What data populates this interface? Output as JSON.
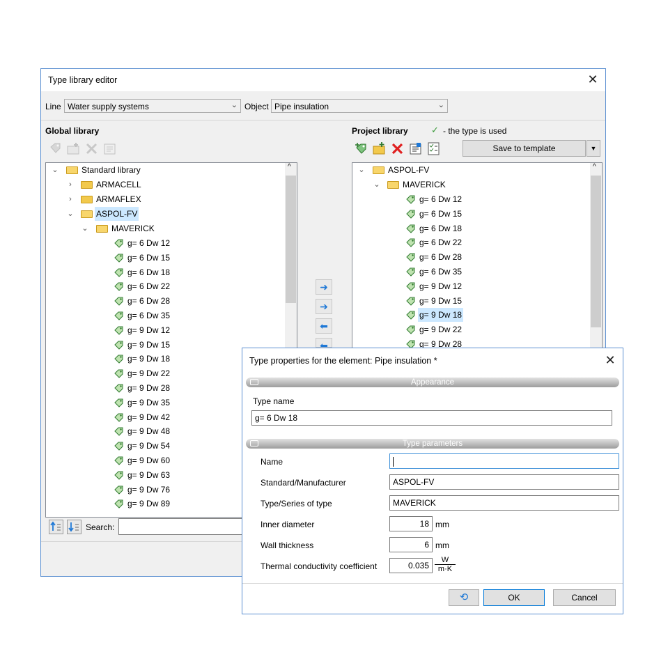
{
  "main_window": {
    "title": "Type library editor",
    "line_label": "Line",
    "line_value": "Water supply systems",
    "object_label": "Object",
    "object_value": "Pipe insulation",
    "global_library_label": "Global library",
    "project_library_label": "Project library",
    "used_legend": "- the type is used",
    "save_to_template_label": "Save to template",
    "search_label": "Search:",
    "search_value": ""
  },
  "global_tree": {
    "root": "Standard library",
    "folders": [
      "ARMACELL",
      "ARMAFLEX",
      "ASPOL-FV"
    ],
    "subfolder": "MAVERICK",
    "items": [
      "g= 6 Dw 12",
      "g= 6 Dw 15",
      "g= 6 Dw 18",
      "g= 6 Dw 22",
      "g= 6 Dw 28",
      "g= 6 Dw 35",
      "g= 9 Dw 12",
      "g= 9 Dw 15",
      "g= 9 Dw 18",
      "g= 9 Dw 22",
      "g= 9 Dw 28",
      "g= 9 Dw 35",
      "g= 9 Dw 42",
      "g= 9 Dw 48",
      "g= 9 Dw 54",
      "g= 9 Dw 60",
      "g= 9 Dw 63",
      "g= 9 Dw 76",
      "g= 9 Dw 89"
    ],
    "selected": "ASPOL-FV"
  },
  "project_tree": {
    "root": "ASPOL-FV",
    "subfolder": "MAVERICK",
    "items": [
      "g= 6 Dw 12",
      "g= 6 Dw 15",
      "g= 6 Dw 18",
      "g= 6 Dw 22",
      "g= 6 Dw 28",
      "g= 6 Dw 35",
      "g= 9 Dw 12",
      "g= 9 Dw 15",
      "g= 9 Dw 18",
      "g= 9 Dw 22",
      "g= 9 Dw 28"
    ],
    "selected": "g= 9 Dw 18"
  },
  "dialog": {
    "title": "Type properties for the element: Pipe insulation *",
    "appearance_section": "Appearance",
    "type_name_label": "Type name",
    "type_name_value": "g= 6 Dw 18",
    "type_parameters_section": "Type parameters",
    "name_label": "Name",
    "name_value": "",
    "manufacturer_label": "Standard/Manufacturer",
    "manufacturer_value": "ASPOL-FV",
    "series_label": "Type/Series of type",
    "series_value": "MAVERICK",
    "inner_diameter_label": "Inner diameter",
    "inner_diameter_value": "18",
    "inner_diameter_unit": "mm",
    "wall_thickness_label": "Wall thickness",
    "wall_thickness_value": "6",
    "wall_thickness_unit": "mm",
    "conductivity_label": "Thermal conductivity coefficient",
    "conductivity_value": "0.035",
    "conductivity_unit_num": "W",
    "conductivity_unit_den": "m·K",
    "ok_label": "OK",
    "cancel_label": "Cancel"
  },
  "colors": {
    "accent": "#5b8fd1",
    "selection": "#cce8ff",
    "folder": "#f2c94c",
    "tag": "#3a9a3a",
    "arrow": "#1e78d6",
    "delete": "#e02020"
  }
}
